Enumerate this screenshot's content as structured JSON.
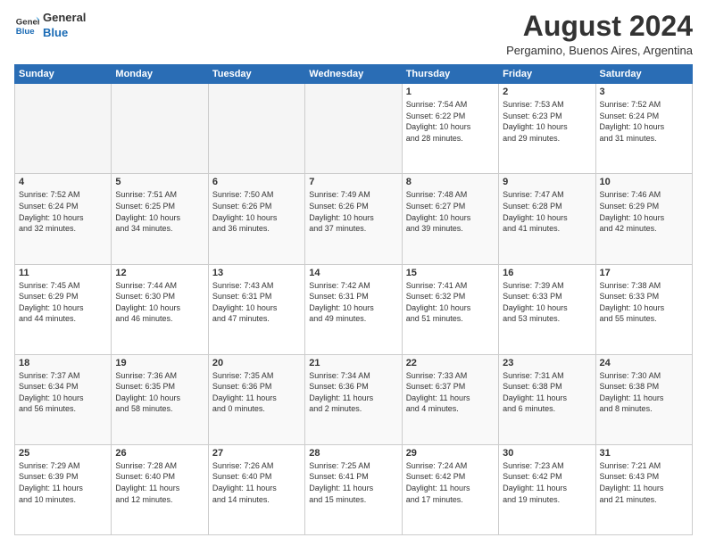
{
  "logo": {
    "line1": "General",
    "line2": "Blue"
  },
  "title": "August 2024",
  "location": "Pergamino, Buenos Aires, Argentina",
  "days_of_week": [
    "Sunday",
    "Monday",
    "Tuesday",
    "Wednesday",
    "Thursday",
    "Friday",
    "Saturday"
  ],
  "weeks": [
    [
      {
        "day": "",
        "info": ""
      },
      {
        "day": "",
        "info": ""
      },
      {
        "day": "",
        "info": ""
      },
      {
        "day": "",
        "info": ""
      },
      {
        "day": "1",
        "info": "Sunrise: 7:54 AM\nSunset: 6:22 PM\nDaylight: 10 hours\nand 28 minutes."
      },
      {
        "day": "2",
        "info": "Sunrise: 7:53 AM\nSunset: 6:23 PM\nDaylight: 10 hours\nand 29 minutes."
      },
      {
        "day": "3",
        "info": "Sunrise: 7:52 AM\nSunset: 6:24 PM\nDaylight: 10 hours\nand 31 minutes."
      }
    ],
    [
      {
        "day": "4",
        "info": "Sunrise: 7:52 AM\nSunset: 6:24 PM\nDaylight: 10 hours\nand 32 minutes."
      },
      {
        "day": "5",
        "info": "Sunrise: 7:51 AM\nSunset: 6:25 PM\nDaylight: 10 hours\nand 34 minutes."
      },
      {
        "day": "6",
        "info": "Sunrise: 7:50 AM\nSunset: 6:26 PM\nDaylight: 10 hours\nand 36 minutes."
      },
      {
        "day": "7",
        "info": "Sunrise: 7:49 AM\nSunset: 6:26 PM\nDaylight: 10 hours\nand 37 minutes."
      },
      {
        "day": "8",
        "info": "Sunrise: 7:48 AM\nSunset: 6:27 PM\nDaylight: 10 hours\nand 39 minutes."
      },
      {
        "day": "9",
        "info": "Sunrise: 7:47 AM\nSunset: 6:28 PM\nDaylight: 10 hours\nand 41 minutes."
      },
      {
        "day": "10",
        "info": "Sunrise: 7:46 AM\nSunset: 6:29 PM\nDaylight: 10 hours\nand 42 minutes."
      }
    ],
    [
      {
        "day": "11",
        "info": "Sunrise: 7:45 AM\nSunset: 6:29 PM\nDaylight: 10 hours\nand 44 minutes."
      },
      {
        "day": "12",
        "info": "Sunrise: 7:44 AM\nSunset: 6:30 PM\nDaylight: 10 hours\nand 46 minutes."
      },
      {
        "day": "13",
        "info": "Sunrise: 7:43 AM\nSunset: 6:31 PM\nDaylight: 10 hours\nand 47 minutes."
      },
      {
        "day": "14",
        "info": "Sunrise: 7:42 AM\nSunset: 6:31 PM\nDaylight: 10 hours\nand 49 minutes."
      },
      {
        "day": "15",
        "info": "Sunrise: 7:41 AM\nSunset: 6:32 PM\nDaylight: 10 hours\nand 51 minutes."
      },
      {
        "day": "16",
        "info": "Sunrise: 7:39 AM\nSunset: 6:33 PM\nDaylight: 10 hours\nand 53 minutes."
      },
      {
        "day": "17",
        "info": "Sunrise: 7:38 AM\nSunset: 6:33 PM\nDaylight: 10 hours\nand 55 minutes."
      }
    ],
    [
      {
        "day": "18",
        "info": "Sunrise: 7:37 AM\nSunset: 6:34 PM\nDaylight: 10 hours\nand 56 minutes."
      },
      {
        "day": "19",
        "info": "Sunrise: 7:36 AM\nSunset: 6:35 PM\nDaylight: 10 hours\nand 58 minutes."
      },
      {
        "day": "20",
        "info": "Sunrise: 7:35 AM\nSunset: 6:36 PM\nDaylight: 11 hours\nand 0 minutes."
      },
      {
        "day": "21",
        "info": "Sunrise: 7:34 AM\nSunset: 6:36 PM\nDaylight: 11 hours\nand 2 minutes."
      },
      {
        "day": "22",
        "info": "Sunrise: 7:33 AM\nSunset: 6:37 PM\nDaylight: 11 hours\nand 4 minutes."
      },
      {
        "day": "23",
        "info": "Sunrise: 7:31 AM\nSunset: 6:38 PM\nDaylight: 11 hours\nand 6 minutes."
      },
      {
        "day": "24",
        "info": "Sunrise: 7:30 AM\nSunset: 6:38 PM\nDaylight: 11 hours\nand 8 minutes."
      }
    ],
    [
      {
        "day": "25",
        "info": "Sunrise: 7:29 AM\nSunset: 6:39 PM\nDaylight: 11 hours\nand 10 minutes."
      },
      {
        "day": "26",
        "info": "Sunrise: 7:28 AM\nSunset: 6:40 PM\nDaylight: 11 hours\nand 12 minutes."
      },
      {
        "day": "27",
        "info": "Sunrise: 7:26 AM\nSunset: 6:40 PM\nDaylight: 11 hours\nand 14 minutes."
      },
      {
        "day": "28",
        "info": "Sunrise: 7:25 AM\nSunset: 6:41 PM\nDaylight: 11 hours\nand 15 minutes."
      },
      {
        "day": "29",
        "info": "Sunrise: 7:24 AM\nSunset: 6:42 PM\nDaylight: 11 hours\nand 17 minutes."
      },
      {
        "day": "30",
        "info": "Sunrise: 7:23 AM\nSunset: 6:42 PM\nDaylight: 11 hours\nand 19 minutes."
      },
      {
        "day": "31",
        "info": "Sunrise: 7:21 AM\nSunset: 6:43 PM\nDaylight: 11 hours\nand 21 minutes."
      }
    ]
  ]
}
